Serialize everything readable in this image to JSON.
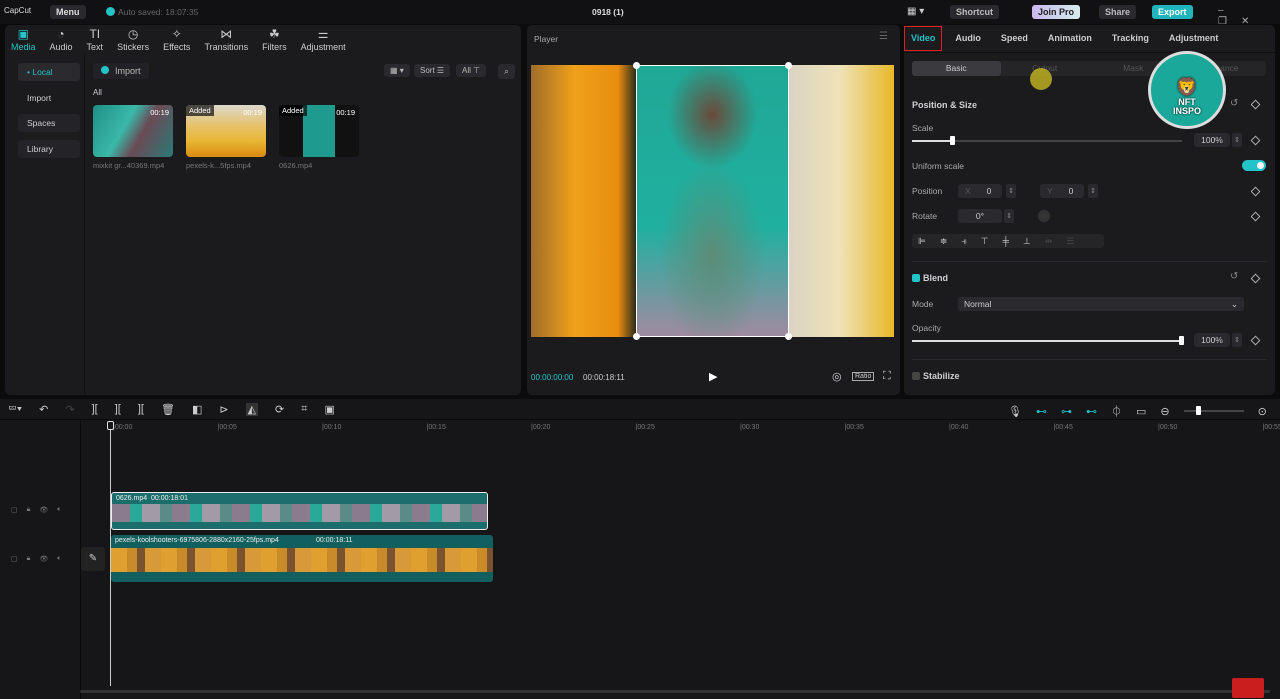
{
  "app": {
    "logo": "CapCut",
    "menu": "Menu",
    "autosave": "Auto saved: 18:07:35",
    "project": "0918 (1)",
    "shortcut": "Shortcut",
    "join_pro": "Join Pro",
    "share": "Share",
    "export": "Export"
  },
  "media_tabs": [
    {
      "label": "Media",
      "icon": "▣"
    },
    {
      "label": "Audio",
      "icon": "◔"
    },
    {
      "label": "Text",
      "icon": "TI"
    },
    {
      "label": "Stickers",
      "icon": "◷"
    },
    {
      "label": "Effects",
      "icon": "✧"
    },
    {
      "label": "Transitions",
      "icon": "⋈"
    },
    {
      "label": "Filters",
      "icon": "☘"
    },
    {
      "label": "Adjustment",
      "icon": "⚌"
    }
  ],
  "sidebar": [
    "• Local",
    "Import",
    "Spaces",
    "Library"
  ],
  "media": {
    "import": "Import",
    "sort": "Sort",
    "all_filter": "All",
    "section": "All",
    "items": [
      {
        "name": "mixkit gr...40369.mp4",
        "duration": "00:19",
        "added": ""
      },
      {
        "name": "pexels-k...5fps.mp4",
        "duration": "00:19",
        "added": "Added"
      },
      {
        "name": "0626.mp4",
        "duration": "00:19",
        "added": "Added"
      }
    ]
  },
  "player": {
    "title": "Player",
    "current": "00:00:00:00",
    "total": "00:00:18:11",
    "ratio": "Ratio"
  },
  "inspector": {
    "tabs": [
      "Video",
      "Audio",
      "Speed",
      "Animation",
      "Tracking",
      "Adjustment"
    ],
    "subtabs": [
      "Basic",
      "Cutout",
      "Mask",
      "Enhance"
    ],
    "position_size": "Position & Size",
    "scale_label": "Scale",
    "scale": "100%",
    "scale_value": 0.15,
    "uniform_scale": "Uniform scale",
    "uniform_on": true,
    "position": "Position",
    "x_label": "X",
    "x": "0",
    "y_label": "Y",
    "y": "0",
    "rotate": "Rotate",
    "rotate_value": "0°",
    "blend": "Blend",
    "mode_label": "Mode",
    "mode": "Normal",
    "opacity_label": "Opacity",
    "opacity": "100%",
    "opacity_value": 1.0,
    "stabilize": "Stabilize"
  },
  "watermark": {
    "line1": "NFT",
    "line2": "INSPO"
  },
  "timeline": {
    "ticks": [
      "00:00",
      "00:05",
      "00:10",
      "00:15",
      "00:20",
      "00:25",
      "00:30",
      "00:35",
      "00:40",
      "00:45",
      "00:50",
      "00:55"
    ],
    "clips": [
      {
        "name": "0626.mp4",
        "duration": "00:00:18:01"
      },
      {
        "name": "pexels-koolshooters-6975806-2880x2160-25fps.mp4",
        "duration": "00:00:18:11"
      }
    ]
  },
  "colors": {
    "accent": "#22c3c9",
    "export": "#1fb5bd",
    "highlight_box": "#e02020"
  }
}
